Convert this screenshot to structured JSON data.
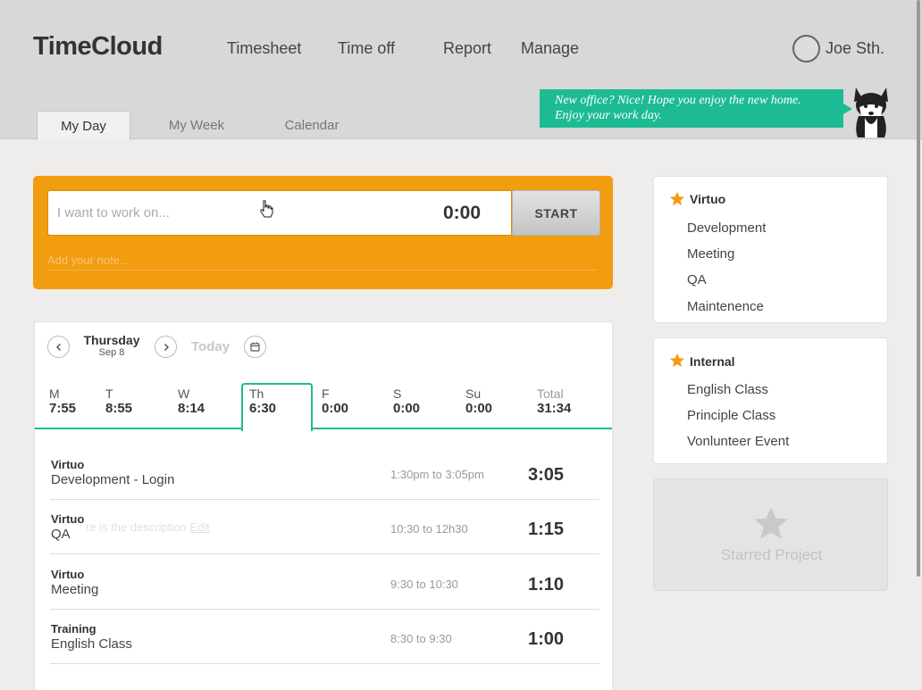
{
  "app": {
    "logo": "TimeCloud"
  },
  "nav": {
    "timesheet": "Timesheet",
    "timeoff": "Time off",
    "report": "Report",
    "manage": "Manage"
  },
  "user": {
    "name": "Joe Sth."
  },
  "tabs": {
    "myday": "My Day",
    "myweek": "My Week",
    "calendar": "Calendar"
  },
  "tip": {
    "line1": "New office? Nice! Hope you enjoy the new home.",
    "line2": "Enjoy your work day."
  },
  "timer": {
    "placeholder": "I want to work on...",
    "value": "",
    "time": "0:00",
    "start_label": "START",
    "note_placeholder": "Add your note..."
  },
  "day": {
    "name": "Thursday",
    "date": "Sep 8",
    "today_label": "Today"
  },
  "week": [
    {
      "letter": "M",
      "hours": "7:55"
    },
    {
      "letter": "T",
      "hours": "8:55"
    },
    {
      "letter": "W",
      "hours": "8:14"
    },
    {
      "letter": "Th",
      "hours": "6:30"
    },
    {
      "letter": "F",
      "hours": "0:00"
    },
    {
      "letter": "S",
      "hours": "0:00"
    },
    {
      "letter": "Su",
      "hours": "0:00"
    },
    {
      "letter": "Total",
      "hours": "31:34"
    }
  ],
  "entries": [
    {
      "project": "Virtuo",
      "task": "Development - Login",
      "range": "1:30pm to 3:05pm",
      "duration": "3:05"
    },
    {
      "project": "Virtuo",
      "task": "QA",
      "range": "10:30 to 12h30",
      "duration": "1:15"
    },
    {
      "project": "Virtuo",
      "task": "Meeting",
      "range": "9:30 to 10:30",
      "duration": "1:10"
    },
    {
      "project": "Training",
      "task": "English Class",
      "range": "8:30 to 9:30",
      "duration": "1:00"
    }
  ],
  "ghost": {
    "text": "re is the description",
    "edit": "Edit"
  },
  "projects": {
    "virtuo": {
      "title": "Virtuo",
      "items": [
        "Development",
        "Meeting",
        "QA",
        "Maintenence"
      ]
    },
    "internal": {
      "title": "Internal",
      "items": [
        "English Class",
        "Principle Class",
        "Vonlunteer Event"
      ]
    }
  },
  "starred": {
    "label": "Starred Project"
  },
  "colors": {
    "accent_orange": "#f29c10",
    "accent_green": "#22bb8c",
    "tip_green": "#1dbb94",
    "star_orange": "#f29c10"
  },
  "icons": {
    "prev": "chevron-left-icon",
    "next": "chevron-right-icon",
    "calendar": "calendar-icon",
    "star": "star-icon",
    "cursor": "hand-cursor-icon",
    "mascot": "husky-mascot-icon"
  }
}
